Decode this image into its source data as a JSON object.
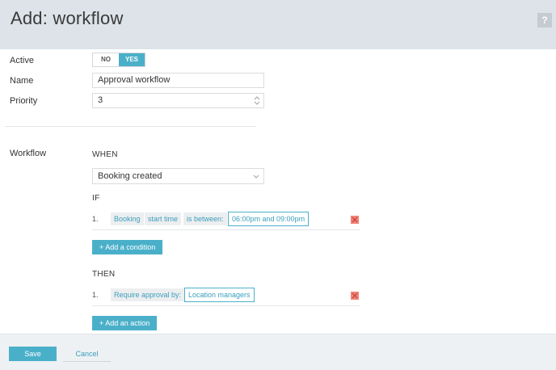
{
  "header": {
    "title": "Add: workflow",
    "help_label": "?"
  },
  "form": {
    "active": {
      "label": "Active",
      "no_label": "NO",
      "yes_label": "YES",
      "selected": "YES"
    },
    "name": {
      "label": "Name",
      "value": "Approval workflow"
    },
    "priority": {
      "label": "Priority",
      "value": "3"
    }
  },
  "workflow": {
    "label": "Workflow",
    "when": {
      "title": "WHEN",
      "trigger": "Booking created"
    },
    "if": {
      "title": "IF",
      "conditions": [
        {
          "number": "1.",
          "subject": "Booking",
          "field": "start time",
          "operator": "is between:",
          "value": "06:00pm and 09:00pm"
        }
      ],
      "add_label": "+ Add a condition"
    },
    "then": {
      "title": "THEN",
      "actions": [
        {
          "number": "1.",
          "action": "Require approval by:",
          "value": "Location managers"
        }
      ],
      "add_label": "+ Add an action"
    }
  },
  "footer": {
    "save_label": "Save",
    "cancel_label": "Cancel"
  },
  "colors": {
    "accent": "#4ab0c9",
    "delete": "#f1837a",
    "header_bg": "#dde3e8"
  }
}
